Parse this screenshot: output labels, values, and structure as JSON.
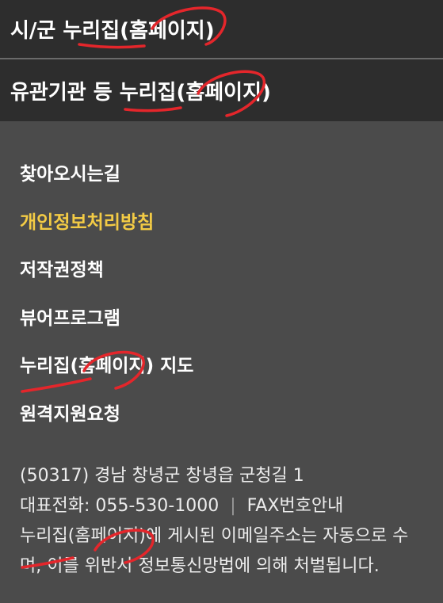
{
  "header": {
    "city_county_sites": "시/군 누리집(홈페이지)",
    "agency_sites": "유관기관 등 누리집(홈페이지)"
  },
  "footer_links": [
    {
      "label": "찾아오시는길",
      "active": false
    },
    {
      "label": "개인정보처리방침",
      "active": true
    },
    {
      "label": "저작권정책",
      "active": false
    },
    {
      "label": "뷰어프로그램",
      "active": false
    },
    {
      "label": "누리집(홈페이지) 지도",
      "active": false
    },
    {
      "label": "원격지원요청",
      "active": false
    }
  ],
  "footer_info": {
    "address": "(50317) 경남 창녕군 창녕읍 군청길 1",
    "phone": "대표전화: 055-530-1000",
    "separator": "|",
    "fax": "FAX번호안내",
    "notice_line1": "누리집(홈페이지)에 게시된 이메일주소는 자동으로 수",
    "notice_line2": "며, 이를 위반시 정보통신망법에 의해 처벌됩니다."
  },
  "colors": {
    "background": "#4b4b4b",
    "header_bar": "#2d2d2d",
    "active_link": "#f3cb45",
    "annotation": "#e4262b"
  }
}
